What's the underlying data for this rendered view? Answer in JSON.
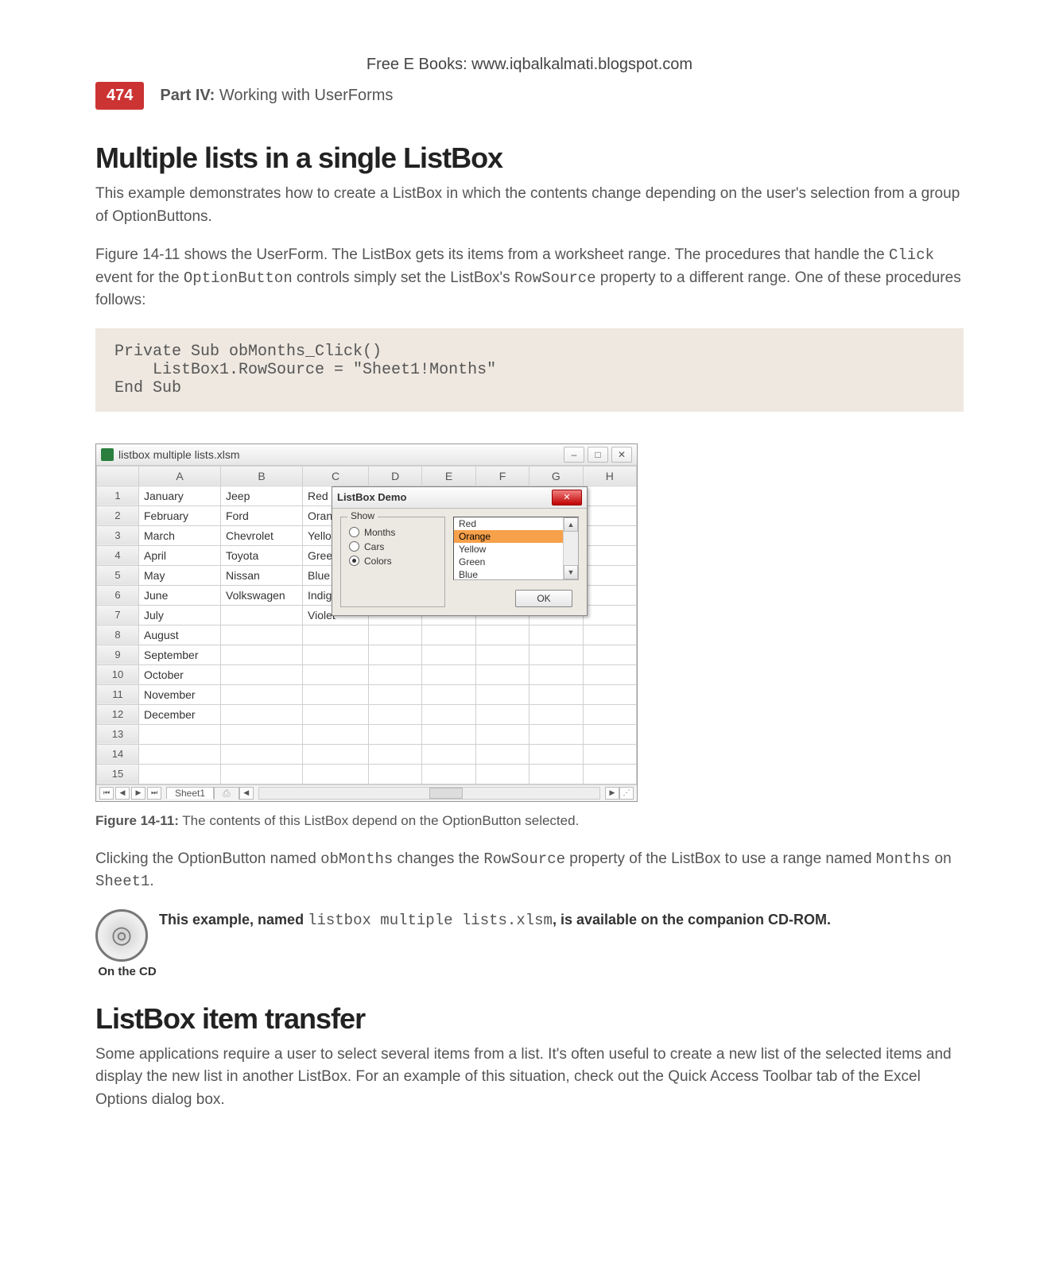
{
  "header": {
    "free_line": "Free E Books: www.iqbalkalmati.blogspot.com",
    "page_number": "474",
    "part_label": "Part IV:",
    "part_text": "Working with UserForms"
  },
  "section1": {
    "heading": "Multiple lists in a single ListBox",
    "para1": "This example demonstrates how to create a ListBox in which the contents change depending on the user's selection from a group of OptionButtons.",
    "para2_a": "Figure 14-11 shows the UserForm. The ListBox gets its items from a worksheet range. The procedures that handle the ",
    "code_click": "Click",
    "para2_b": " event for the ",
    "code_ob": "OptionButton",
    "para2_c": " controls simply set the ListBox's ",
    "code_rs": "RowSource",
    "para2_d": " property to a different range. One of these procedures follows:",
    "code_block": "Private Sub obMonths_Click()\n    ListBox1.RowSource = \"Sheet1!Months\"\nEnd Sub"
  },
  "excel": {
    "title": "listbox multiple lists.xlsm",
    "cols": [
      "A",
      "B",
      "C",
      "D",
      "E",
      "F",
      "G",
      "H"
    ],
    "rows": [
      {
        "n": "1",
        "a": "January",
        "b": "Jeep",
        "c": "Red"
      },
      {
        "n": "2",
        "a": "February",
        "b": "Ford",
        "c": "Orange"
      },
      {
        "n": "3",
        "a": "March",
        "b": "Chevrolet",
        "c": "Yellow"
      },
      {
        "n": "4",
        "a": "April",
        "b": "Toyota",
        "c": "Green"
      },
      {
        "n": "5",
        "a": "May",
        "b": "Nissan",
        "c": "Blue"
      },
      {
        "n": "6",
        "a": "June",
        "b": "Volkswagen",
        "c": "Indigo"
      },
      {
        "n": "7",
        "a": "July",
        "b": "",
        "c": "Violet"
      },
      {
        "n": "8",
        "a": "August",
        "b": "",
        "c": ""
      },
      {
        "n": "9",
        "a": "September",
        "b": "",
        "c": ""
      },
      {
        "n": "10",
        "a": "October",
        "b": "",
        "c": ""
      },
      {
        "n": "11",
        "a": "November",
        "b": "",
        "c": ""
      },
      {
        "n": "12",
        "a": "December",
        "b": "",
        "c": ""
      },
      {
        "n": "13",
        "a": "",
        "b": "",
        "c": ""
      },
      {
        "n": "14",
        "a": "",
        "b": "",
        "c": ""
      },
      {
        "n": "15",
        "a": "",
        "b": "",
        "c": ""
      }
    ],
    "sheet_tab": "Sheet1",
    "min_btn": "–",
    "max_btn": "□",
    "close_btn": "✕"
  },
  "userform": {
    "title": "ListBox Demo",
    "close_label": "✕",
    "group_label": "Show",
    "radio_months": "Months",
    "radio_cars": "Cars",
    "radio_colors": "Colors",
    "list_items": [
      "Red",
      "Orange",
      "Yellow",
      "Green",
      "Blue"
    ],
    "ok_label": "OK",
    "up": "▲",
    "down": "▼"
  },
  "figure": {
    "label": "Figure 14-11:",
    "text": "The contents of this ListBox depend on the OptionButton selected."
  },
  "after_fig": {
    "p_a": "Clicking the OptionButton named ",
    "c1": "obMonths",
    "p_b": " changes the ",
    "c2": "RowSource",
    "p_c": " property of the ListBox to use a range named ",
    "c3": "Months",
    "p_d": " on ",
    "c4": "Sheet1",
    "p_e": "."
  },
  "cd": {
    "label": "On the CD",
    "text_a": "This example, named ",
    "code": "listbox multiple lists.xlsm",
    "text_b": ", is available on the companion CD-ROM."
  },
  "section2": {
    "heading": "ListBox item transfer",
    "para": "Some applications require a user to select several items from a list. It's often useful to create a new list of the selected items and display the new list in another ListBox. For an example of this situation, check out the Quick Access Toolbar tab of the Excel Options dialog box."
  }
}
